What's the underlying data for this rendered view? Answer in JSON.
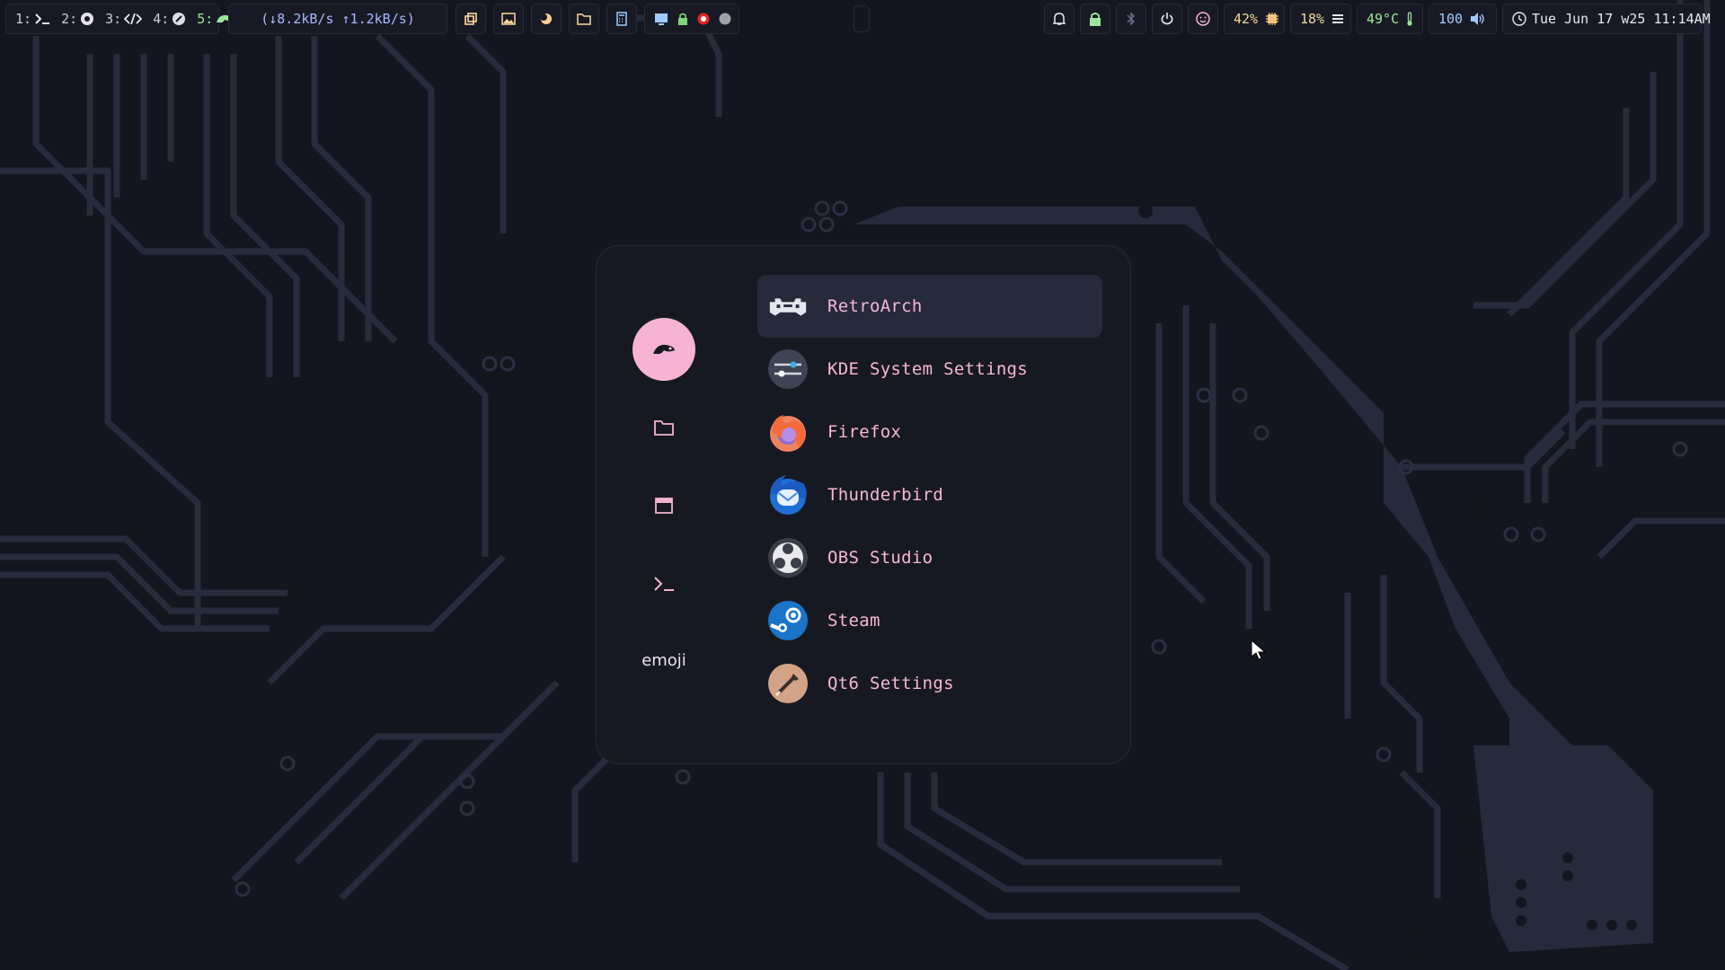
{
  "taskbar": {
    "workspaces": [
      {
        "num": "1:",
        "icon": "terminal-icon"
      },
      {
        "num": "2:",
        "icon": "chrome-icon"
      },
      {
        "num": "3:",
        "icon": "code-icon"
      },
      {
        "num": "4:",
        "icon": "app-icon"
      },
      {
        "num": "5:",
        "icon": "chameleon-icon"
      }
    ],
    "network": "(↓8.2kB/s ↑1.2kB/s)",
    "cpu": "42%",
    "memory": "18%",
    "temperature": "49°C",
    "volume": "100",
    "clock": "Tue Jun 17 w25 11:14AM"
  },
  "launcher": {
    "sidebar": [
      {
        "name": "apps",
        "icon": "chameleon-icon"
      },
      {
        "name": "files",
        "icon": "folder-icon"
      },
      {
        "name": "windows",
        "icon": "window-icon"
      },
      {
        "name": "run",
        "icon": "terminal-icon"
      },
      {
        "name": "emoji",
        "label": "emoji"
      }
    ],
    "apps": [
      {
        "label": "RetroArch",
        "icon": "retroarch-icon"
      },
      {
        "label": "KDE System Settings",
        "icon": "kde-settings-icon"
      },
      {
        "label": "Firefox",
        "icon": "firefox-icon"
      },
      {
        "label": "Thunderbird",
        "icon": "thunderbird-icon"
      },
      {
        "label": "OBS Studio",
        "icon": "obs-icon"
      },
      {
        "label": "Steam",
        "icon": "steam-icon"
      },
      {
        "label": "Qt6 Settings",
        "icon": "qt6-settings-icon"
      }
    ]
  },
  "colors": {
    "background": "#14161f",
    "accent": "#f6b3d3",
    "circuit": "#2a3042",
    "panel": "#171922",
    "selection": "#262a3a"
  }
}
